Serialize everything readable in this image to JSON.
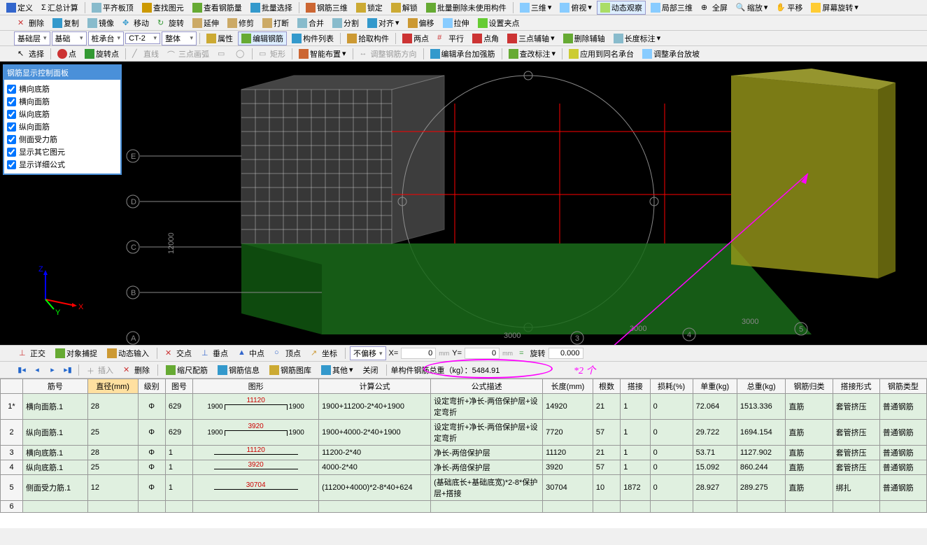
{
  "toolbar1": {
    "define": "定义",
    "sum_calc": "汇总计算",
    "flat_top": "平齐板顶",
    "find_element": "查找图元",
    "view_rebar": "查看钢筋量",
    "batch_select": "批量选择",
    "rebar_3d": "钢筋三维",
    "lock": "锁定",
    "unlock": "解锁",
    "batch_delete": "批量删除未使用构件",
    "three_d": "三维",
    "obliq": "俯视",
    "dynamic": "动态观察",
    "local_3d": "局部三维",
    "fullscreen": "全屏",
    "zoom": "缩放",
    "pan": "平移",
    "screen_rotate": "屏幕旋转"
  },
  "toolbar2": {
    "delete": "删除",
    "copy": "复制",
    "mirror": "镜像",
    "move": "移动",
    "rotate": "旋转",
    "extend": "延伸",
    "trim": "修剪",
    "break": "打断",
    "merge": "合并",
    "split": "分割",
    "align": "对齐",
    "offset": "偏移",
    "stretch": "拉伸",
    "set_pivot": "设置夹点"
  },
  "toolbar3": {
    "layer": "基础层",
    "category": "基础",
    "sub": "桩承台",
    "code": "CT-2",
    "whole": "整体",
    "prop": "属性",
    "edit_rebar": "编辑钢筋",
    "member_list": "构件列表",
    "pick_member": "拾取构件",
    "two_pt": "两点",
    "parallel": "平行",
    "pt_angle": "点角",
    "three_pt": "三点辅轴",
    "del_aux": "删除辅轴",
    "len_annot": "长度标注"
  },
  "toolbar4": {
    "select": "选择",
    "point": "点",
    "rotate_pt": "旋转点",
    "line": "直线",
    "three_arc": "三点画弧",
    "rect": "矩形",
    "smart_layout": "智能布置",
    "adjust_rebar_dir": "调整钢筋方向",
    "edit_cap_rebar": "编辑承台加强筋",
    "modify_annot": "查改标注",
    "apply_same": "应用到同名承台",
    "adjust_slope": "调整承台放坡"
  },
  "panel": {
    "title": "钢筋显示控制面板",
    "items": [
      "横向底筋",
      "横向面筋",
      "纵向底筋",
      "纵向面筋",
      "侧面受力筋",
      "显示其它图元",
      "显示详细公式"
    ]
  },
  "statusbar": {
    "ortho": "正交",
    "obj_snap": "对象捕捉",
    "dyn_input": "动态输入",
    "intersect": "交点",
    "perp": "垂点",
    "mid": "中点",
    "apex": "顶点",
    "coord": "坐标",
    "no_offset": "不偏移",
    "x_val": "0",
    "y_val": "0",
    "rotate": "旋转",
    "rot_val": "0.000"
  },
  "midtools": {
    "insert": "插入",
    "delete": "删除",
    "scale_rebar": "缩尺配筋",
    "rebar_info": "钢筋信息",
    "rebar_lib": "钢筋图库",
    "other": "其他",
    "close": "关闭",
    "total_weight_label": "单构件钢筋总重（kg）：5484.91"
  },
  "annot": {
    "multiply": "*2 个"
  },
  "table": {
    "headers": [
      "筋号",
      "直径(mm)",
      "级别",
      "图号",
      "图形",
      "计算公式",
      "公式描述",
      "长度(mm)",
      "根数",
      "搭接",
      "损耗(%)",
      "单重(kg)",
      "总重(kg)",
      "钢筋归类",
      "搭接形式",
      "钢筋类型"
    ],
    "rows": [
      {
        "idx": "1*",
        "name": "横向面筋.1",
        "dia": "28",
        "grade": "Φ",
        "fig": "629",
        "shape_l": "1900",
        "shape_m": "11120",
        "shape_r": "1900",
        "formula": "1900+11200-2*40+1900",
        "desc": "设定弯折+净长-两倍保护层+设定弯折",
        "len": "14920",
        "cnt": "21",
        "lap": "1",
        "loss": "0",
        "uw": "72.064",
        "tw": "1513.336",
        "cat": "直筋",
        "lapform": "套管挤压",
        "type": "普通钢筋"
      },
      {
        "idx": "2",
        "name": "纵向面筋.1",
        "dia": "25",
        "grade": "Φ",
        "fig": "629",
        "shape_l": "1900",
        "shape_m": "3920",
        "shape_r": "1900",
        "formula": "1900+4000-2*40+1900",
        "desc": "设定弯折+净长-两倍保护层+设定弯折",
        "len": "7720",
        "cnt": "57",
        "lap": "1",
        "loss": "0",
        "uw": "29.722",
        "tw": "1694.154",
        "cat": "直筋",
        "lapform": "套管挤压",
        "type": "普通钢筋"
      },
      {
        "idx": "3",
        "name": "横向底筋.1",
        "dia": "28",
        "grade": "Φ",
        "fig": "1",
        "shape_l": "",
        "shape_m": "11120",
        "shape_r": "",
        "formula": "11200-2*40",
        "desc": "净长-两倍保护层",
        "len": "11120",
        "cnt": "21",
        "lap": "1",
        "loss": "0",
        "uw": "53.71",
        "tw": "1127.902",
        "cat": "直筋",
        "lapform": "套管挤压",
        "type": "普通钢筋"
      },
      {
        "idx": "4",
        "name": "纵向底筋.1",
        "dia": "25",
        "grade": "Φ",
        "fig": "1",
        "shape_l": "",
        "shape_m": "3920",
        "shape_r": "",
        "formula": "4000-2*40",
        "desc": "净长-两倍保护层",
        "len": "3920",
        "cnt": "57",
        "lap": "1",
        "loss": "0",
        "uw": "15.092",
        "tw": "860.244",
        "cat": "直筋",
        "lapform": "套管挤压",
        "type": "普通钢筋"
      },
      {
        "idx": "5",
        "name": "侧面受力筋.1",
        "dia": "12",
        "grade": "Φ",
        "fig": "1",
        "shape_l": "",
        "shape_m": "30704",
        "shape_r": "",
        "formula": "(11200+4000)*2-8*40+624",
        "desc": "(基础底长+基础底宽)*2-8*保护层+搭接",
        "len": "30704",
        "cnt": "10",
        "lap": "1872",
        "loss": "0",
        "uw": "28.927",
        "tw": "289.275",
        "cat": "直筋",
        "lapform": "绑扎",
        "type": "普通钢筋"
      }
    ]
  },
  "viewport_labels": {
    "axes": [
      "A",
      "B",
      "C",
      "D",
      "E"
    ],
    "dim_v": "12000",
    "dim_h": "3000",
    "nums": [
      "3",
      "4",
      "5"
    ]
  }
}
